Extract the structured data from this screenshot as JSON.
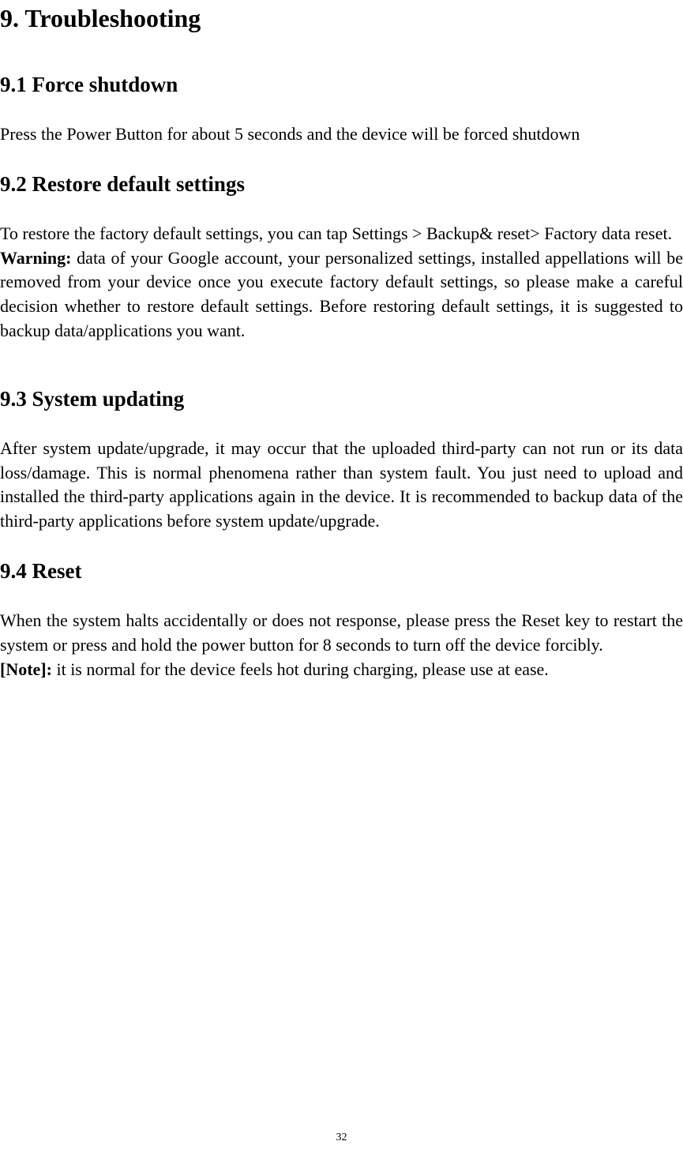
{
  "title": "9. Troubleshooting",
  "sections": {
    "s1": {
      "heading": "9.1 Force shutdown",
      "body": "Press the Power Button for about 5 seconds and the device will be forced shutdown"
    },
    "s2": {
      "heading": "9.2 Restore default settings",
      "intro": "To restore the factory default settings, you can tap Settings > Backup& reset> Factory data reset.",
      "warning_label": "Warning:",
      "warning_body": " data of your Google account, your personalized settings, installed appellations will be removed from your device once you execute factory default settings, so please make a careful decision whether to restore default settings. Before restoring default settings, it is suggested to backup data/applications you want."
    },
    "s3": {
      "heading": "9.3 System updating",
      "body": "After system update/upgrade, it may occur that the uploaded third-party can not run or its data loss/damage. This is normal phenomena rather than system fault. You just need to upload and installed the third-party applications again in the device. It is recommended to backup data of the third-party applications before system update/upgrade."
    },
    "s4": {
      "heading": "9.4 Reset",
      "body": "When the system halts accidentally or does not response, please press the Reset key to restart the system or press and hold the power button for 8 seconds to turn off the device forcibly.",
      "note_label": "[Note]:",
      "note_body": " it is normal for the device feels hot during charging, please use at ease."
    }
  },
  "page_number": "32"
}
